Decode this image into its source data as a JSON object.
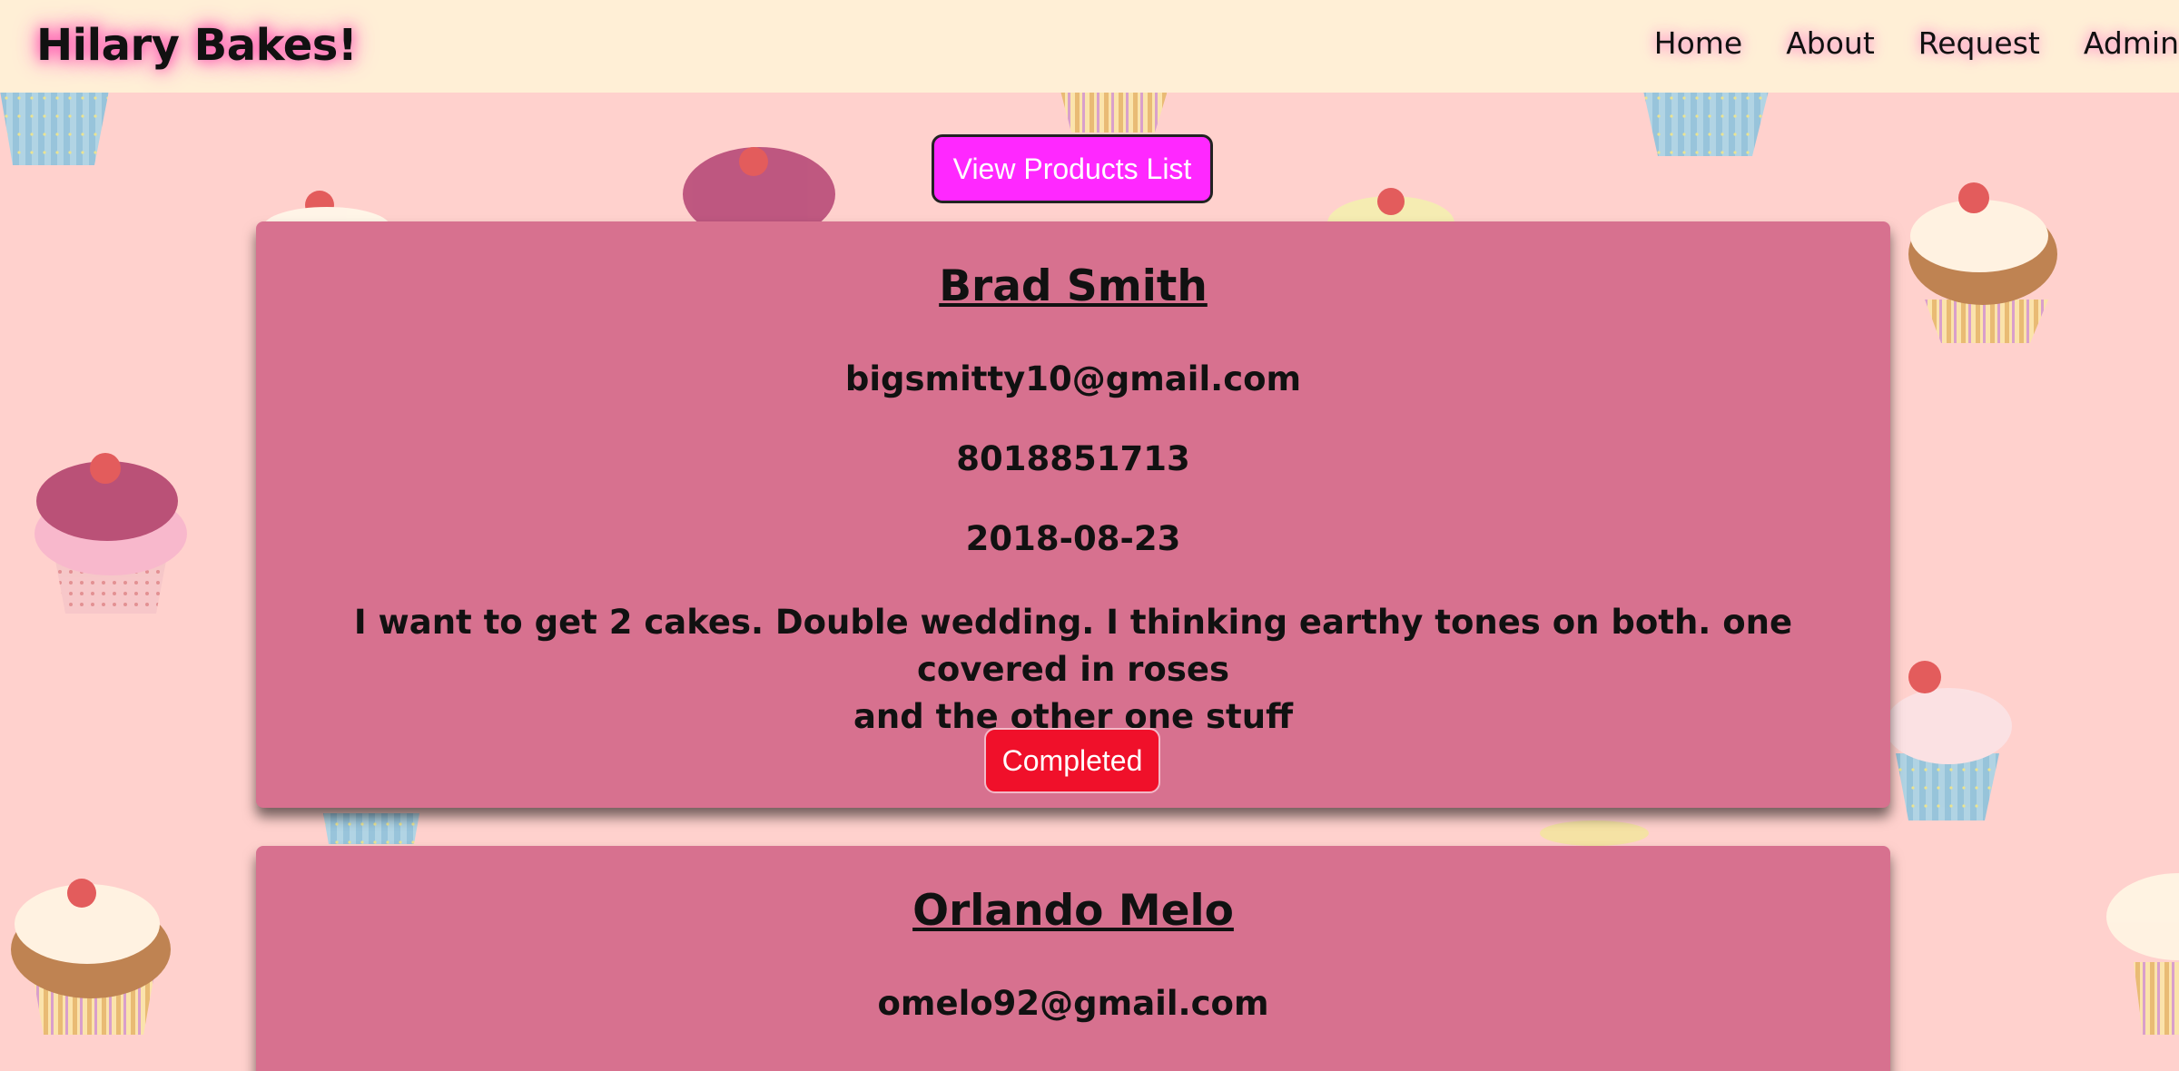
{
  "navbar": {
    "brand": "Hilary Bakes!",
    "links": [
      "Home",
      "About",
      "Request",
      "Admin"
    ]
  },
  "actions": {
    "view_products_label": "View Products List"
  },
  "requests": [
    {
      "name": "Brad Smith",
      "email": "bigsmitty10@gmail.com",
      "phone": "8018851713",
      "date": "2018-08-23",
      "message_line1": "I want to get 2 cakes. Double wedding. I thinking earthy tones on both. one covered in roses",
      "message_line2": "and the other one stuff",
      "status_label": "Completed"
    },
    {
      "name": "Orlando Melo",
      "email": "omelo92@gmail.com"
    }
  ],
  "colors": {
    "background": "#ffd1cd",
    "navbar": "#ffefd6",
    "card": "#d7718f",
    "products_button": "#ff28ff",
    "completed_button": "#f0102a"
  }
}
